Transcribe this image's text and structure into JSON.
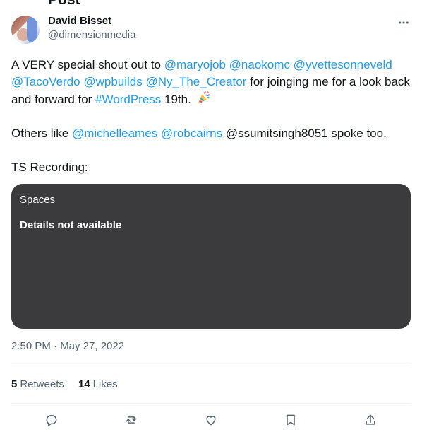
{
  "header": {
    "cut_title": "Post"
  },
  "post": {
    "author_name": "David Bisset",
    "author_handle": "@dimensionmedia",
    "intro": "A VERY special shout out to ",
    "mentions_line_1": [
      "@maryojob",
      "@naokomc",
      "@yvettesonneveld"
    ],
    "mentions_line_2": [
      "@TacoVerdo",
      "@wpbuilds",
      "@Ny_The_Creator"
    ],
    "after_mentions": " for joinging me for a look back and forward for ",
    "hashtag": "#WordPress",
    "after_hashtag": " 19th. ",
    "emoji_icon": "party-popper-icon",
    "others_prefix": "Others like ",
    "others_mentions": [
      "@michelleames",
      "@robcairns"
    ],
    "others_suffix": " @ssumitsingh8051 spoke too.",
    "recording_label": "TS Recording:",
    "spaces_label": "Spaces",
    "spaces_status": "Details not available",
    "timestamp": "2:50 PM · May 27, 2022",
    "retweets_count": "5",
    "retweets_label": "Retweets",
    "likes_count": "14",
    "likes_label": "Likes"
  },
  "icons": {
    "more": "more-icon",
    "reply": "reply-icon",
    "retweet": "retweet-icon",
    "like": "heart-icon",
    "bookmark": "bookmark-icon",
    "share": "share-icon"
  },
  "colors": {
    "link": "#1d9bf0",
    "text": "#0f1419",
    "muted": "#536471",
    "card": "#3b3b3d",
    "divider": "#eff3f4"
  }
}
